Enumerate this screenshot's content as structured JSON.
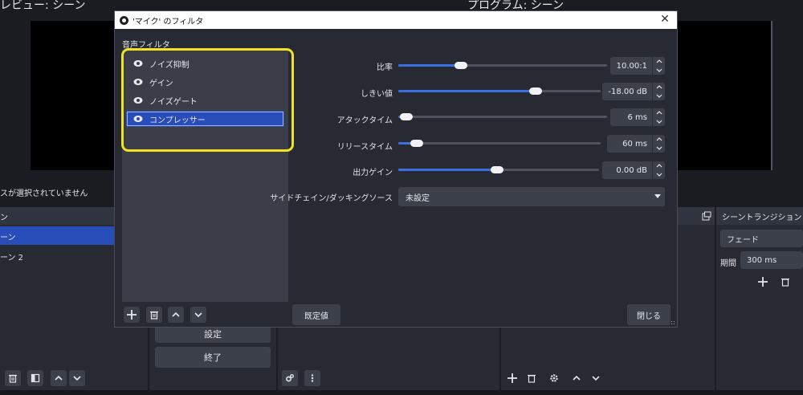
{
  "background": {
    "preview_title": "レビュー: シーン",
    "program_title": "プログラム: シーン",
    "no_source_text": "スが選択されていません",
    "scenes_header": "ン",
    "scene_items": [
      "ーン",
      "ーン 2"
    ],
    "controls_buttons": [
      "設定",
      "終了"
    ],
    "transition_header": "シーントランジション",
    "transition_value": "フェード",
    "duration_label": "期間",
    "duration_value": "300 ms"
  },
  "dialog": {
    "title": "'マイク' のフィルタ",
    "section_label": "音声フィルタ",
    "filters": [
      {
        "name": "ノイズ抑制",
        "selected": false,
        "icon": "eye-icon"
      },
      {
        "name": "ゲイン",
        "selected": false,
        "icon": "eye-icon"
      },
      {
        "name": "ノイズゲート",
        "selected": false,
        "icon": "eye-icon"
      },
      {
        "name": "コンプレッサー",
        "selected": true,
        "icon": "eye-icon"
      }
    ],
    "properties": [
      {
        "label": "比率",
        "value": "10.00:1",
        "level": 0.3
      },
      {
        "label": "しきい値",
        "value": "-18.00 dB",
        "level": 0.68
      },
      {
        "label": "アタックタイム",
        "value": "6 ms",
        "level": 0.04
      },
      {
        "label": "リリースタイム",
        "value": "60 ms",
        "level": 0.09
      },
      {
        "label": "出力ゲイン",
        "value": "0.00 dB",
        "level": 0.49
      }
    ],
    "sidechain_label": "サイドチェイン/ダッキングソース",
    "sidechain_value": "未設定",
    "defaults_button": "既定値",
    "close_button": "閉じる"
  },
  "colors": {
    "accent": "#284cb8",
    "slider_fill": "#3c6fe0",
    "highlight": "#f0e323"
  }
}
